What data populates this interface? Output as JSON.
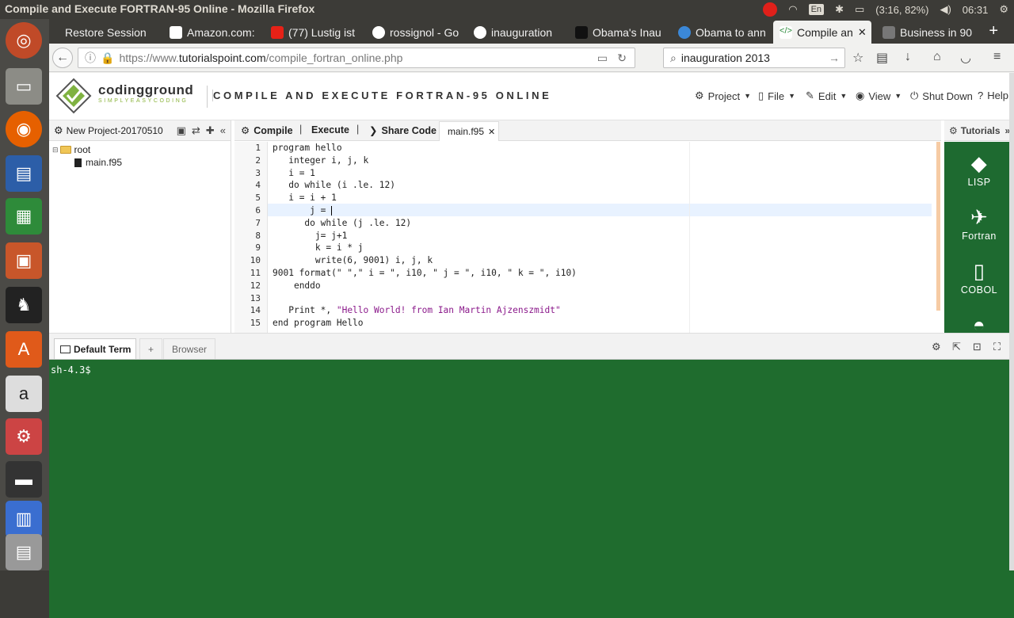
{
  "window_title": "Compile and Execute FORTRAN-95 Online - Mozilla Firefox",
  "tray": {
    "lang": "En",
    "battery": "(3:16, 82%)",
    "clock": "06:31"
  },
  "tabs": [
    {
      "label": "Restore Session",
      "icon_color": "#3c3b37",
      "icon": "restore-icon"
    },
    {
      "label": "Amazon.com:",
      "icon_color": "#222222",
      "icon": "amazon-icon"
    },
    {
      "label": "(77) Lustig ist",
      "icon_color": "#e62117",
      "icon": "youtube-icon"
    },
    {
      "label": "rossignol - Go",
      "icon_color": "#ffffff",
      "icon": "google-icon"
    },
    {
      "label": "inauguration",
      "icon_color": "#ffffff",
      "icon": "google-icon"
    },
    {
      "label": "Obama's Inau",
      "icon_color": "#000000",
      "icon": "nyt-icon"
    },
    {
      "label": "Obama to ann",
      "icon_color": "#3b88d8",
      "icon": "news-icon"
    },
    {
      "label": "Compile an",
      "icon_color": "#2a8a3a",
      "icon": "code-icon",
      "active": true
    },
    {
      "label": "Business in 90",
      "icon_color": "#555555",
      "icon": "business-icon"
    }
  ],
  "nav": {
    "url_scheme": "https://www.",
    "url_host": "tutorialspoint.com",
    "url_path": "/compile_fortran_online.php",
    "search_value": "inauguration 2013"
  },
  "site": {
    "brand": "codingground",
    "tagline": "SIMPLYEASYCODING",
    "page_title": "COMPILE AND EXECUTE FORTRAN-95 ONLINE",
    "menu": [
      "Project",
      "File",
      "Edit",
      "View",
      "Shut Down",
      "Help"
    ]
  },
  "project": {
    "name": "New Project-20170510",
    "tree_root": "root",
    "tree_file": "main.f95"
  },
  "editor_toolbar": {
    "compile": "Compile",
    "execute": "Execute",
    "share": "Share Code",
    "separator": "|",
    "file_tab": "main.f95"
  },
  "code_lines": [
    {
      "n": "1",
      "indent": "",
      "text": "program hello",
      "str": "",
      "after": ""
    },
    {
      "n": "2",
      "indent": "   ",
      "text": "integer i, j, k",
      "str": "",
      "after": ""
    },
    {
      "n": "3",
      "indent": "   ",
      "text": "i = 1",
      "str": "",
      "after": ""
    },
    {
      "n": "4",
      "indent": "   ",
      "text": "do while (i .le. 12)",
      "str": "",
      "after": ""
    },
    {
      "n": "5",
      "indent": "   ",
      "text": "i = i + 1",
      "str": "",
      "after": ""
    },
    {
      "n": "6",
      "indent": "       ",
      "text": "j = ",
      "str": "",
      "after": ""
    },
    {
      "n": "7",
      "indent": "      ",
      "text": "do while (j .le. 12)",
      "str": "",
      "after": ""
    },
    {
      "n": "8",
      "indent": "        ",
      "text": "j= j+1",
      "str": "",
      "after": ""
    },
    {
      "n": "9",
      "indent": "        ",
      "text": "k = i * j",
      "str": "",
      "after": ""
    },
    {
      "n": "10",
      "indent": "        ",
      "text": "write(6, 9001) i, j, k",
      "str": "",
      "after": ""
    },
    {
      "n": "11",
      "indent": "",
      "text": "9001 format(\" \",\" i = \", i10, \" j = \", i10, \" k = \", i10)",
      "str": "",
      "after": ""
    },
    {
      "n": "12",
      "indent": "    ",
      "text": "enddo",
      "str": "",
      "after": ""
    },
    {
      "n": "13",
      "indent": "",
      "text": "",
      "str": "",
      "after": ""
    },
    {
      "n": "14",
      "indent": "   ",
      "text": "Print *, ",
      "str": "\"Hello World! from Ian Martin Ajzenszmidt\"",
      "after": ""
    },
    {
      "n": "15",
      "indent": "",
      "text": "end program Hello",
      "str": "",
      "after": ""
    }
  ],
  "tutorials": {
    "header": "Tutorials",
    "items": [
      "LISP",
      "Fortran",
      "COBOL"
    ]
  },
  "terminal": {
    "tab_default": "Default Term",
    "tab_add": "+",
    "tab_browser": "Browser",
    "prompt": "sh-4.3$"
  }
}
